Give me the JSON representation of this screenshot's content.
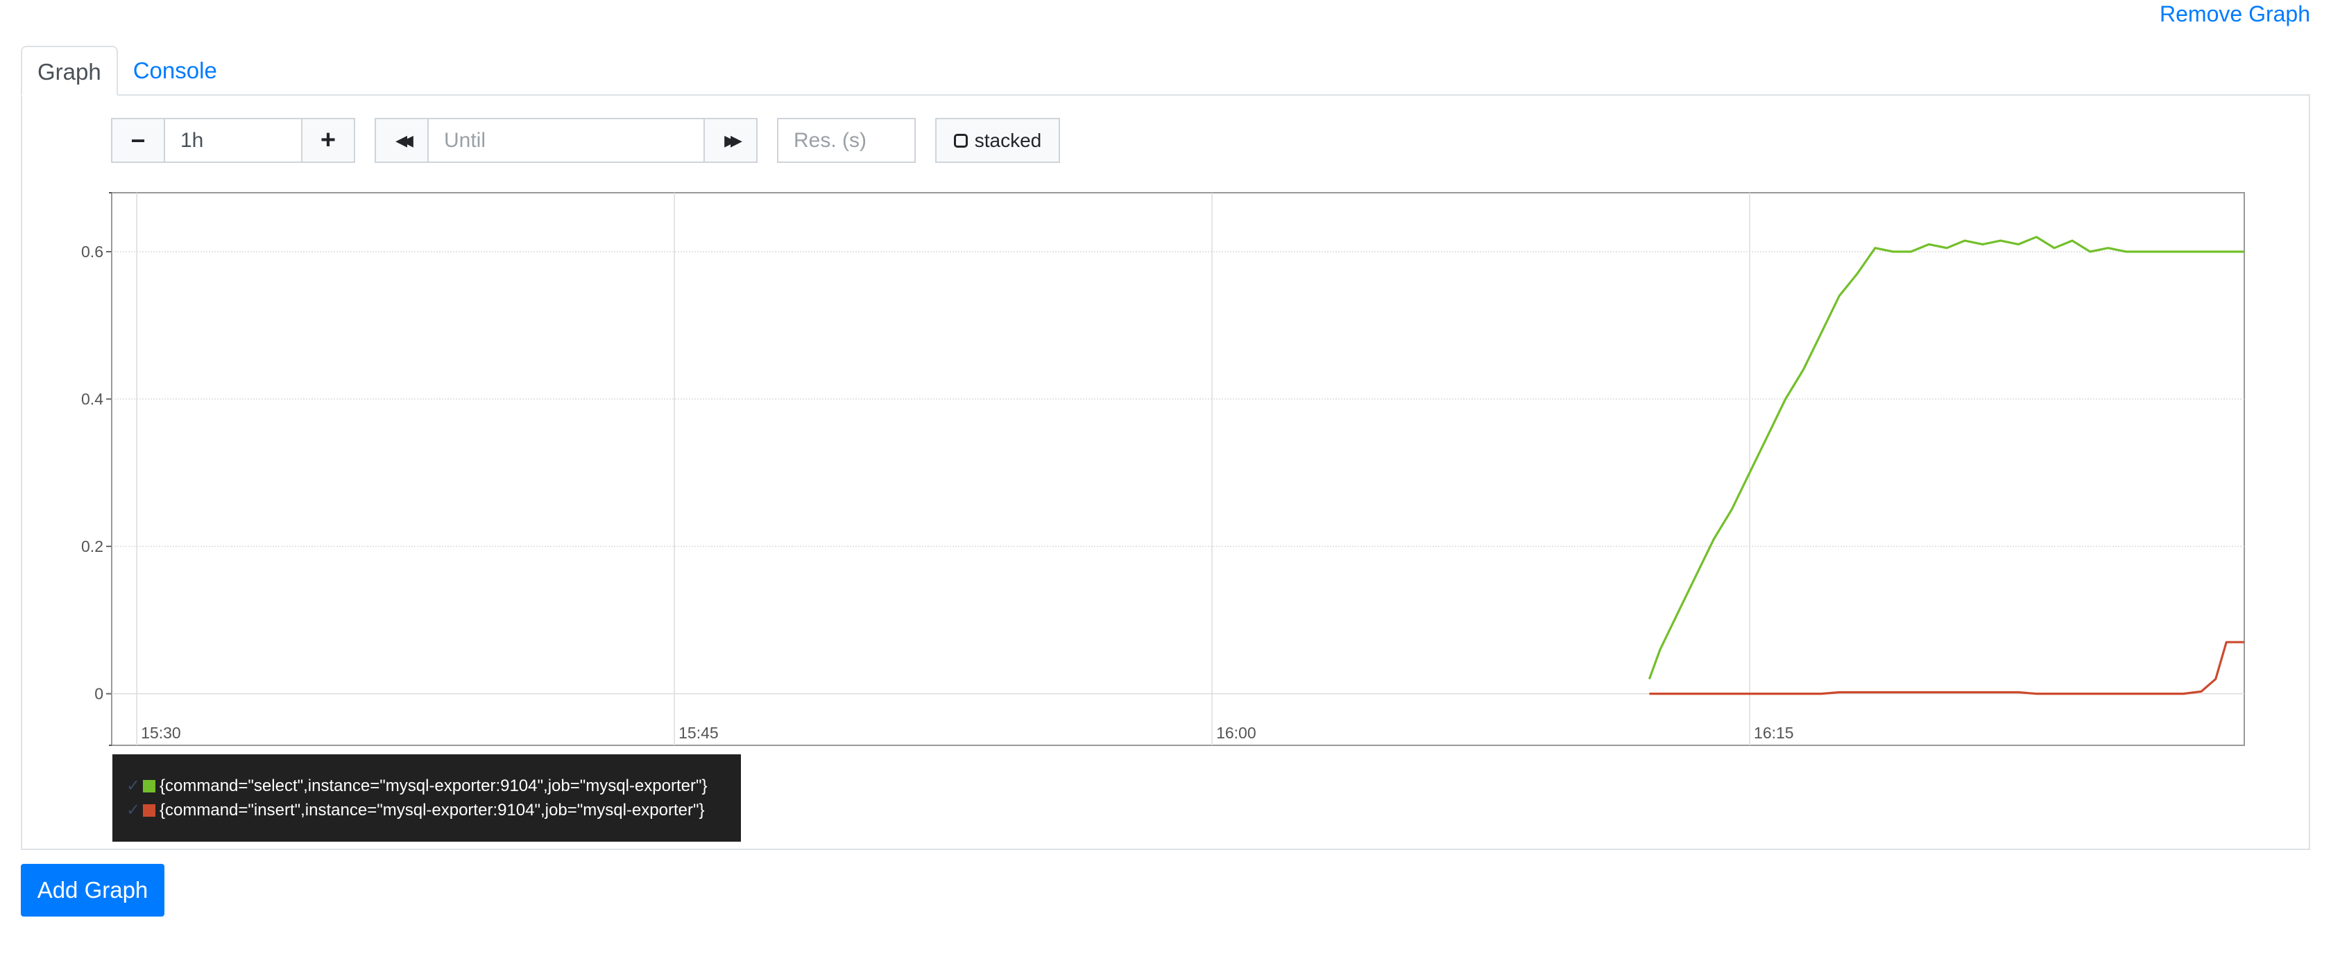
{
  "header": {
    "remove_graph_label": "Remove Graph"
  },
  "tabs": [
    {
      "label": "Graph"
    },
    {
      "label": "Console"
    }
  ],
  "controls": {
    "minus_label": "−",
    "range_value": "1h",
    "plus_label": "+",
    "back_label": "◀◀",
    "until_placeholder": "Until",
    "forward_label": "▶▶",
    "resolution_placeholder": "Res. (s)",
    "stacked_label": "stacked"
  },
  "legend": [
    {
      "label": "{command=\"select\",instance=\"mysql-exporter:9104\",job=\"mysql-exporter\"}",
      "color": "#73bf2b"
    },
    {
      "label": "{command=\"insert\",instance=\"mysql-exporter:9104\",job=\"mysql-exporter\"}",
      "color": "#cb4b2e"
    }
  ],
  "footer": {
    "add_graph_label": "Add Graph"
  },
  "chart_data": {
    "type": "line",
    "x_unit": "time (HH:MM)",
    "xticks": [
      "15:30",
      "15:45",
      "16:00",
      "16:15"
    ],
    "xlim": [
      "15:29.3",
      "16:28.8"
    ],
    "yticks": [
      "0",
      "0.2",
      "0.4",
      "0.6"
    ],
    "ylim": [
      -0.07,
      0.68
    ],
    "grid": true,
    "series": [
      {
        "name": "{command=\"select\",instance=\"mysql-exporter:9104\",job=\"mysql-exporter\"}",
        "color": "#73bf2b",
        "x": [
          "16:12.2",
          "16:12.5",
          "16:13",
          "16:13.5",
          "16:14",
          "16:14.5",
          "16:15",
          "16:15.5",
          "16:16",
          "16:16.5",
          "16:17",
          "16:17.5",
          "16:18",
          "16:18.5",
          "16:19",
          "16:19.5",
          "16:20",
          "16:20.5",
          "16:21",
          "16:21.5",
          "16:22",
          "16:22.5",
          "16:23",
          "16:23.5",
          "16:24",
          "16:24.5",
          "16:25",
          "16:25.5",
          "16:26",
          "16:26.5",
          "16:27",
          "16:27.5",
          "16:28",
          "16:28.5",
          "16:28.8"
        ],
        "values": [
          0.02,
          0.06,
          0.11,
          0.16,
          0.21,
          0.25,
          0.3,
          0.35,
          0.4,
          0.44,
          0.49,
          0.54,
          0.57,
          0.605,
          0.6,
          0.6,
          0.61,
          0.605,
          0.615,
          0.61,
          0.615,
          0.61,
          0.62,
          0.605,
          0.615,
          0.6,
          0.605,
          0.6,
          0.6,
          0.6,
          0.6,
          0.6,
          0.6,
          0.6,
          0.6
        ]
      },
      {
        "name": "{command=\"insert\",instance=\"mysql-exporter:9104\",job=\"mysql-exporter\"}",
        "color": "#cb4b2e",
        "x": [
          "16:12.2",
          "16:17",
          "16:17.5",
          "16:22.5",
          "16:23",
          "16:27.1",
          "16:27.6",
          "16:28",
          "16:28.3",
          "16:28.8"
        ],
        "values": [
          0,
          0,
          0.002,
          0.002,
          0,
          0,
          0.003,
          0.02,
          0.07,
          0.07
        ]
      }
    ]
  }
}
